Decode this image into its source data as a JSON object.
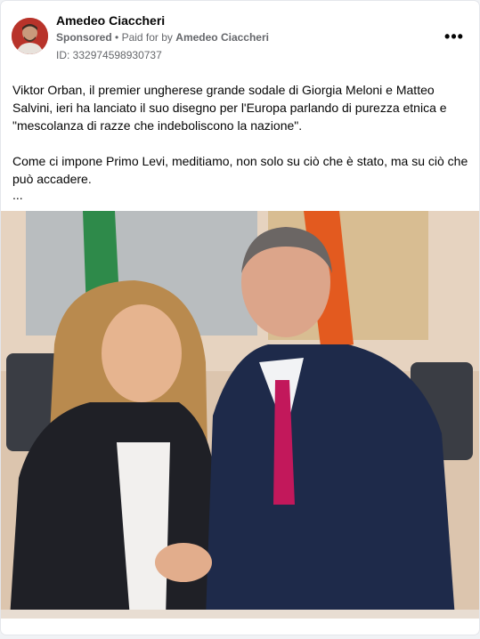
{
  "post": {
    "author": "Amedeo Ciaccheri",
    "sponsored": "Sponsored",
    "separator": "•",
    "paid_for_prefix": "Paid for by",
    "payer": "Amedeo Ciaccheri",
    "ad_id": "ID: 332974598930737",
    "more_label": "•••",
    "paragraph_1": "Viktor Orban, il premier ungherese grande sodale di Giorgia Meloni e Matteo Salvini, ieri ha lanciato il suo disegno per l'Europa parlando di purezza etnica e \"mescolanza di razze che indeboliscono la nazione\".",
    "paragraph_2": "Come ci impone Primo Levi, meditiamo, non solo su ciò che è stato, ma su ciò che può accadere.",
    "see_more": "..."
  },
  "colors": {
    "text_primary": "#050505",
    "text_secondary": "#65676b",
    "background": "#f0f2f5"
  },
  "icons": [
    "more-options-icon"
  ]
}
